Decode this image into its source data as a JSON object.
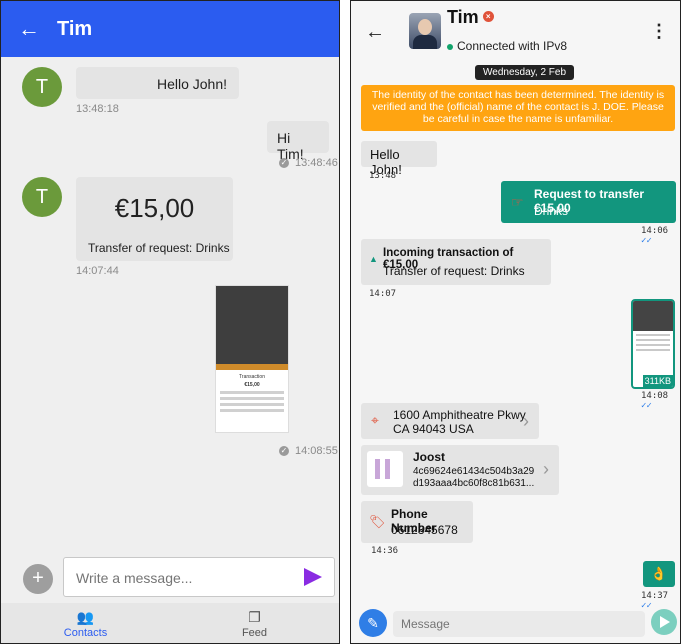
{
  "left": {
    "header": {
      "back_icon": "arrow-left-icon",
      "title": "Tim"
    },
    "messages": [
      {
        "avatar_letter": "T",
        "text": "Hello John!",
        "time": "13:48:18"
      },
      {
        "text": "Hi Tim!",
        "time": "13:48:46"
      },
      {
        "avatar_letter": "T",
        "amount": "€15,00",
        "description": "Transfer of request: Drinks",
        "time": "14:07:44"
      },
      {
        "time": "14:08:55",
        "thumbnail_title": "Transaction",
        "thumbnail_amount": "€15,00"
      }
    ],
    "composer": {
      "placeholder": "Write a message..."
    },
    "nav": {
      "contacts": "Contacts",
      "feed": "Feed"
    }
  },
  "right": {
    "header": {
      "name": "Tim",
      "status": "Connected with IPv8"
    },
    "date": "Wednesday, 2 Feb",
    "warning": "The identity of the contact has been determined. The identity is verified and the (official) name of the contact is J. DOE. Please be careful in case the name is unfamiliar.",
    "messages": {
      "hello": {
        "text": "Hello John!",
        "time": "13:48"
      },
      "request": {
        "title": "Request to transfer €15,00",
        "sub": "Drinks",
        "time": "14:06"
      },
      "incoming": {
        "title": "Incoming transaction of €15,00",
        "sub": "Transfer of request: Drinks",
        "time": "14:07"
      },
      "image": {
        "size": "311KB",
        "time": "14:08"
      },
      "location": {
        "line1": "1600 Amphitheatre Pkwy",
        "line2": "CA 94043 USA"
      },
      "contact": {
        "name": "Joost",
        "key1": "4c69624e61434c504b3a29",
        "key2": "d193aaa4bc60f8c81b631..."
      },
      "phone": {
        "label": "Phone Number",
        "number": "0612345678",
        "time": "14:36"
      },
      "emoji": {
        "time": "14:37"
      }
    },
    "composer": {
      "placeholder": "Message"
    }
  }
}
